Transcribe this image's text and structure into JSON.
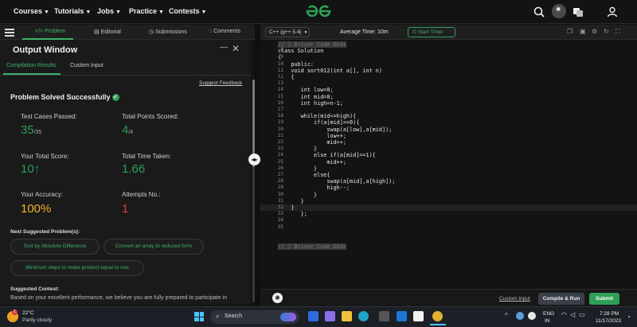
{
  "nav": {
    "items": [
      "Courses",
      "Tutorials",
      "Jobs",
      "Practice",
      "Contests"
    ]
  },
  "toolbar": {
    "tabs": [
      "Problem",
      "Editorial",
      "Submissions",
      "Comments"
    ]
  },
  "output": {
    "title": "Output Window",
    "tabs": [
      "Compilation Results",
      "Custom Input"
    ],
    "feedback": "Suggest Feedback",
    "status": "Problem Solved Successfully",
    "stats": {
      "test_cases_label": "Test Cases Passed:",
      "test_cases_value": "35",
      "test_cases_total": "/35",
      "points_label": "Total Points Scored:",
      "points_value": "4",
      "points_total": "/4",
      "score_label": "Your Total Score:",
      "score_value": "10",
      "score_arrow": "↑",
      "time_label": "Total Time Taken:",
      "time_value": "1.66",
      "accuracy_label": "Your Accuracy:",
      "accuracy_value": "100%",
      "attempts_label": "Attempts No.:",
      "attempts_value": "1"
    },
    "next_title": "Next Suggested Problem(s):",
    "suggestions": [
      "Sort by Absolute Difference",
      "Convert an array to reduced form",
      "Minimum steps to make product equal to one"
    ],
    "contest_title": "Suggested Contest:",
    "contest_text": "Based on your excellent performance, we believe you are fully prepared to participate in"
  },
  "editor": {
    "language": "C++ (g++ 5.4)",
    "avg_time": "Average Time: 10m",
    "start_timer": "Start Timer",
    "lines": [
      {
        "n": "1",
        "t": "// } Driver Code Ends",
        "fold": true
      },
      {
        "n": "8",
        "t": "class Solution"
      },
      {
        "n": "9",
        "t": "{"
      },
      {
        "n": "10",
        "t": "    public:"
      },
      {
        "n": "11",
        "t": "    void sort012(int a[], int n)"
      },
      {
        "n": "12",
        "t": "    {"
      },
      {
        "n": "13",
        "t": ""
      },
      {
        "n": "14",
        "t": "       int low=0;"
      },
      {
        "n": "15",
        "t": "       int mid=0;"
      },
      {
        "n": "16",
        "t": "       int high=n-1;"
      },
      {
        "n": "17",
        "t": ""
      },
      {
        "n": "18",
        "t": "       while(mid<=high){"
      },
      {
        "n": "19",
        "t": "           if(a[mid]==0){"
      },
      {
        "n": "20",
        "t": "               swap(a[low],a[mid]);"
      },
      {
        "n": "21",
        "t": "               low++;"
      },
      {
        "n": "22",
        "t": "               mid++;"
      },
      {
        "n": "23",
        "t": "           }"
      },
      {
        "n": "24",
        "t": "           else if(a[mid]==1){"
      },
      {
        "n": "25",
        "t": "               mid++;"
      },
      {
        "n": "26",
        "t": "           }"
      },
      {
        "n": "27",
        "t": "           else{"
      },
      {
        "n": "28",
        "t": "               swap(a[mid],a[high]);"
      },
      {
        "n": "29",
        "t": "               high--;"
      },
      {
        "n": "30",
        "t": "           }"
      },
      {
        "n": "31",
        "t": "       }"
      },
      {
        "n": "32",
        "t": "    }",
        "current": true
      },
      {
        "n": "33",
        "t": "       };"
      },
      {
        "n": "34",
        "t": ""
      },
      {
        "n": "35",
        "t": ""
      },
      {
        "n": "36",
        "t": "// } Driver Code Ends",
        "fold": true,
        "gap": true
      }
    ],
    "custom_input": "Custom Input",
    "compile_run": "Compile & Run",
    "submit": "Submit"
  },
  "taskbar": {
    "temp": "22°C",
    "weather": "Partly cloudy",
    "search": "Search",
    "lang": "ENG",
    "region": "IN",
    "time": "7:28 PM",
    "date": "11/17/2023",
    "badge": "1"
  },
  "colors": {
    "accent": "#2f9e57",
    "yellow": "#f0b429",
    "red": "#e23b3b",
    "background": "#131313"
  }
}
